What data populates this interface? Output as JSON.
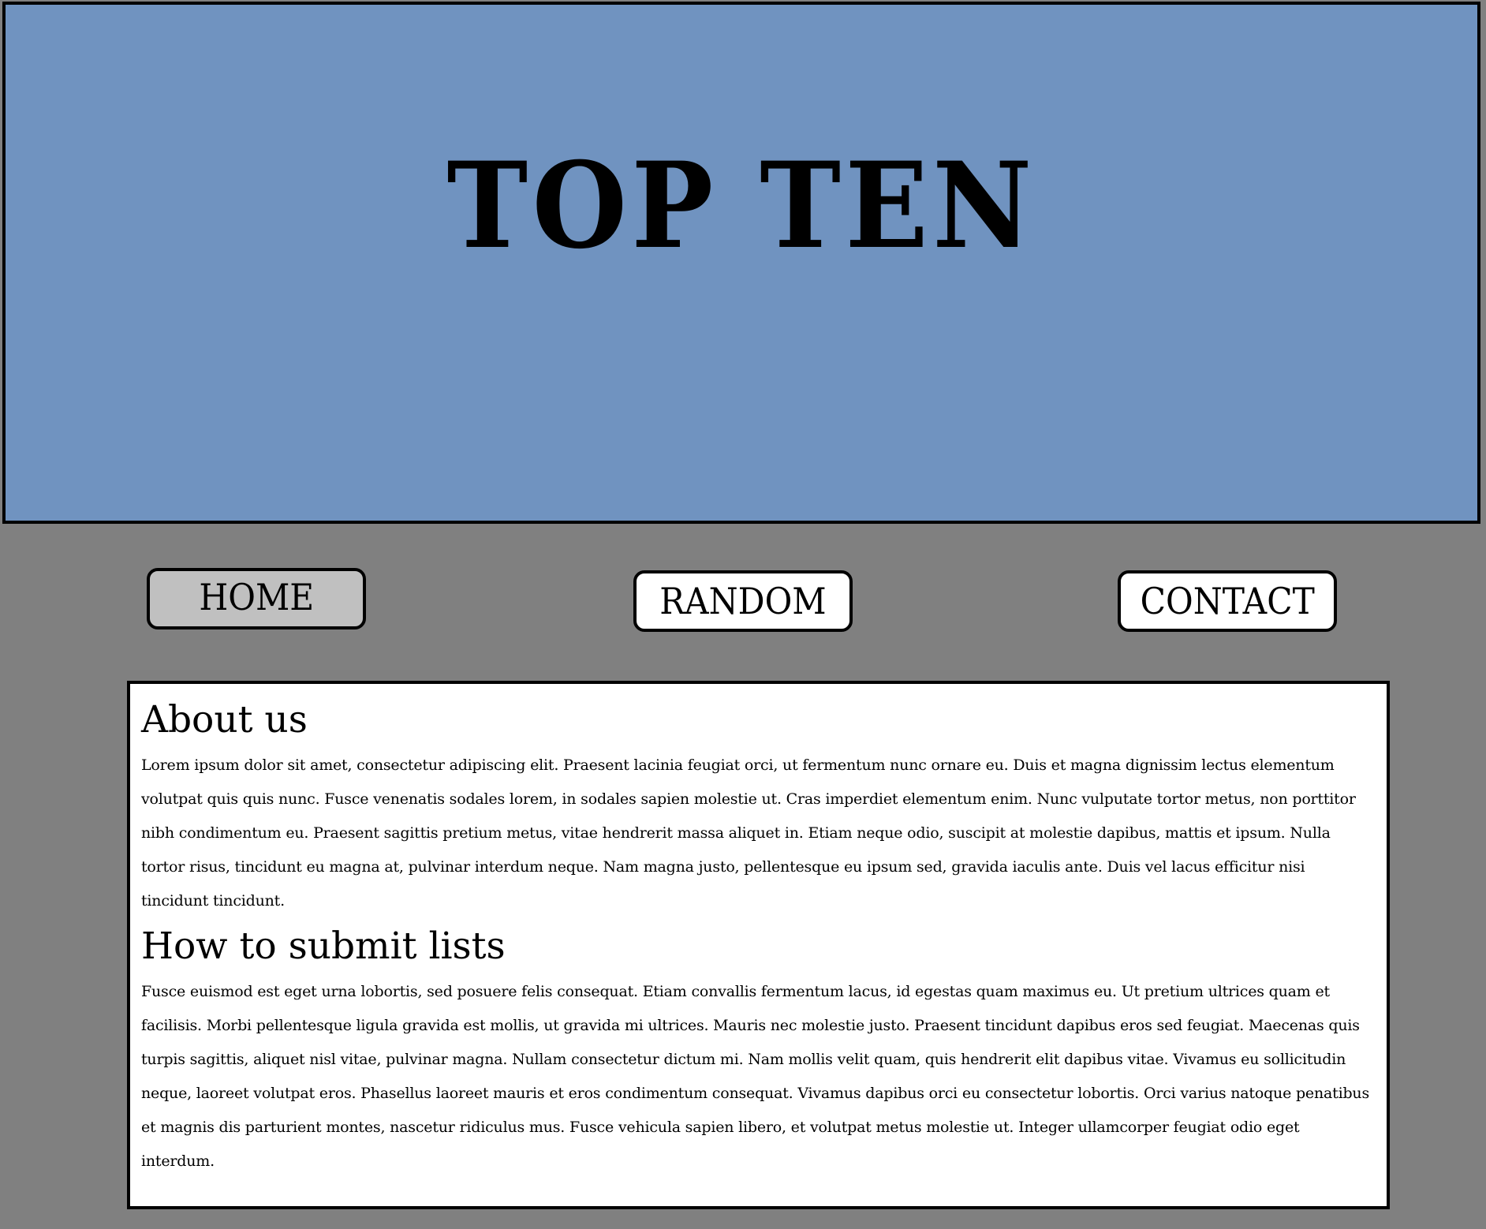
{
  "header": {
    "title": "TOP TEN"
  },
  "nav": {
    "home_label": "HOME",
    "random_label": "RANDOM",
    "contact_label": "CONTACT",
    "active": "HOME"
  },
  "sections": [
    {
      "heading": "About us",
      "body": "Lorem ipsum dolor sit amet, consectetur adipiscing elit. Praesent lacinia feugiat orci, ut fermentum nunc ornare eu. Duis et magna dignissim lectus elementum volutpat quis quis nunc. Fusce venenatis sodales lorem, in sodales sapien molestie ut. Cras imperdiet elementum enim. Nunc vulputate tortor metus, non porttitor nibh condimentum eu. Praesent sagittis pretium metus, vitae hendrerit massa aliquet in. Etiam neque odio, suscipit at molestie dapibus, mattis et ipsum. Nulla tortor risus, tincidunt eu magna at, pulvinar interdum neque. Nam magna justo, pellentesque eu ipsum sed, gravida iaculis ante. Duis vel lacus efficitur nisi tincidunt tincidunt."
    },
    {
      "heading": "How to submit lists",
      "body": "Fusce euismod est eget urna lobortis, sed posuere felis consequat. Etiam convallis fermentum lacus, id egestas quam maximus eu. Ut pretium ultrices quam et facilisis. Morbi pellentesque ligula gravida est mollis, ut gravida mi ultrices. Mauris nec molestie justo. Praesent tincidunt dapibus eros sed feugiat. Maecenas quis turpis sagittis, aliquet nisl vitae, pulvinar magna. Nullam consectetur dictum mi. Nam mollis velit quam, quis hendrerit elit dapibus vitae. Vivamus eu sollicitudin neque, laoreet volutpat eros. Phasellus laoreet mauris et eros condimentum consequat. Vivamus dapibus orci eu consectetur lobortis. Orci varius natoque penatibus et magnis dis parturient montes, nascetur ridiculus mus. Fusce vehicula sapien libero, et volutpat metus molestie ut. Integer ullamcorper feugiat odio eget interdum."
    }
  ],
  "colors": {
    "page_background": "#808080",
    "banner_background": "#7093c0",
    "active_button": "#c0c0c0",
    "button_background": "#ffffff",
    "content_background": "#ffffff",
    "border": "#000000"
  }
}
